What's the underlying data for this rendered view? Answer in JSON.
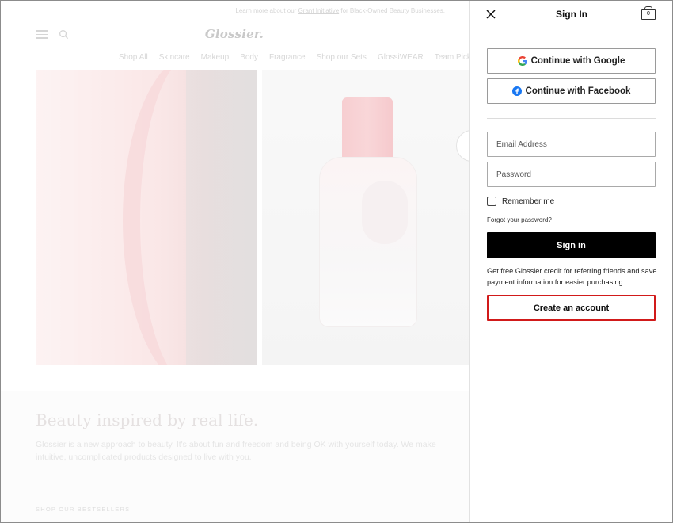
{
  "background_page": {
    "promo": {
      "prefix": "Learn more about our",
      "link": "Grant Initiative",
      "suffix": "for Black-Owned Beauty Businesses."
    },
    "logo": "Glossier.",
    "nav": [
      "Shop All",
      "Skincare",
      "Makeup",
      "Body",
      "Fragrance",
      "Shop our Sets",
      "GlossiWEAR",
      "Team Picks"
    ],
    "tagline": "Beauty inspired by real life.",
    "description": "Glossier is a new approach to beauty. It's about fun and freedom and being OK with yourself today. We make intuitive, uncomplicated products designed to live with you.",
    "bestsellers_heading": "SHOP OUR BESTSELLERS"
  },
  "panel": {
    "title": "Sign In",
    "cart_count": "0",
    "google_label": "Continue with Google",
    "facebook_label": "Continue with Facebook",
    "email_placeholder": "Email Address",
    "password_placeholder": "Password",
    "remember_label": "Remember me",
    "forgot_label": "Forgot your password?",
    "signin_label": "Sign in",
    "benefits_text": "Get free Glossier credit for referring friends and save payment information for easier purchasing.",
    "create_label": "Create an account"
  },
  "colors": {
    "highlight_border": "#d11a1a",
    "facebook_blue": "#1877f2",
    "primary_button": "#000000"
  },
  "icons": [
    "hamburger-menu-icon",
    "search-icon",
    "close-icon",
    "cart-icon",
    "google-icon",
    "facebook-icon"
  ]
}
